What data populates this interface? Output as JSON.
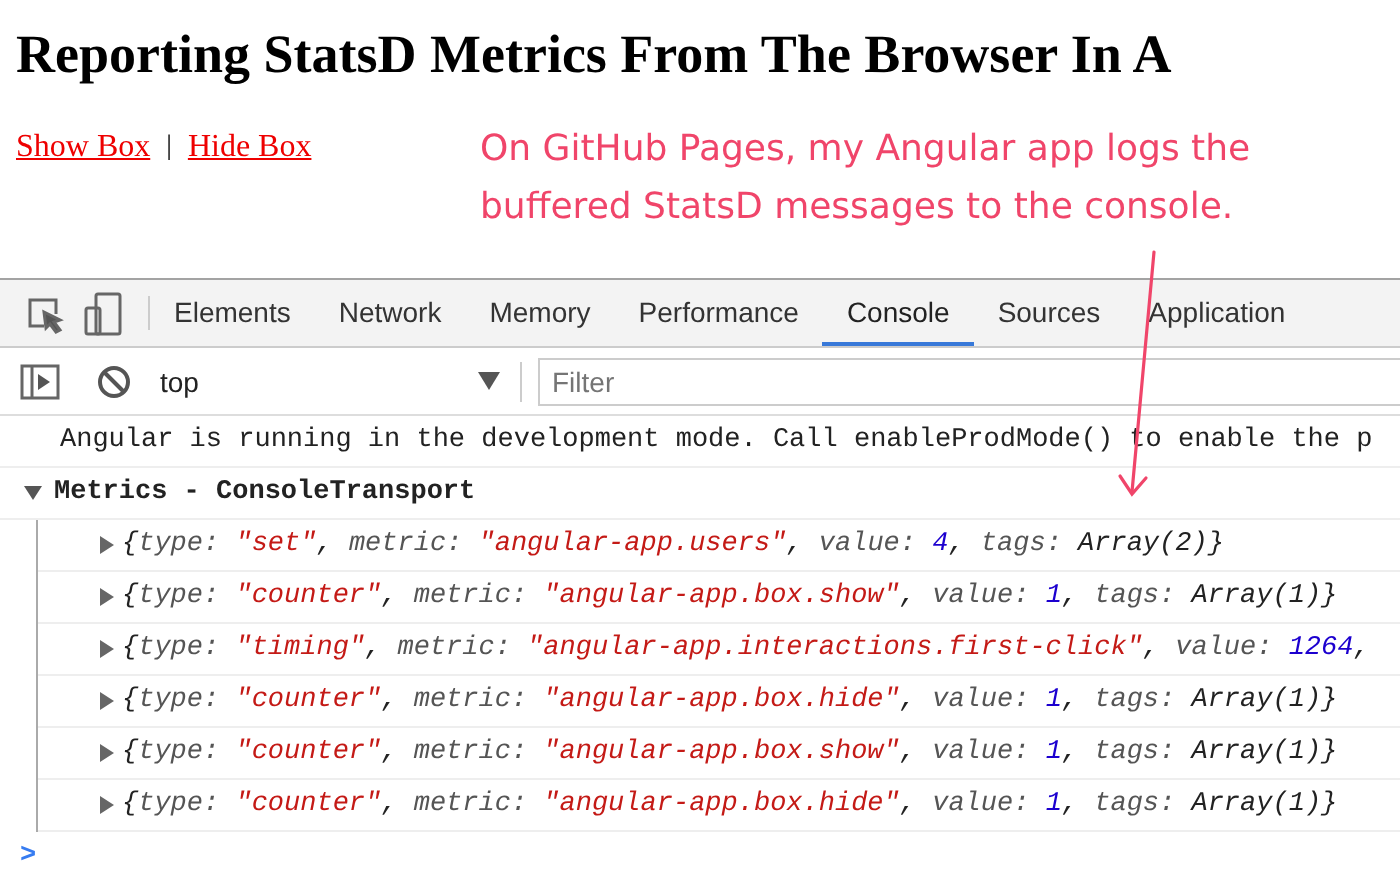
{
  "page": {
    "title": "Reporting StatsD Metrics From The Browser In A",
    "links": [
      {
        "label": "Show Box"
      },
      {
        "label": "Hide Box"
      }
    ],
    "separator": "|"
  },
  "annotation": {
    "lines": [
      "On GitHub Pages, my Angular app logs the",
      "buffered StatsD messages to the console."
    ]
  },
  "devtools": {
    "tabs": [
      {
        "label": "Elements",
        "selected": false
      },
      {
        "label": "Network",
        "selected": false
      },
      {
        "label": "Memory",
        "selected": false
      },
      {
        "label": "Performance",
        "selected": false
      },
      {
        "label": "Console",
        "selected": true
      },
      {
        "label": "Sources",
        "selected": false
      },
      {
        "label": "Application",
        "selected": false
      }
    ],
    "context": "top",
    "filter": {
      "placeholder": "Filter"
    },
    "messages": [
      {
        "kind": "info",
        "text": "Angular is running in the development mode. Call enableProdMode() to enable the p"
      },
      {
        "kind": "group",
        "text": "Metrics - ConsoleTransport",
        "expanded": true,
        "children": [
          {
            "parts": [
              {
                "kind": "p",
                "text": "{"
              },
              {
                "kind": "k",
                "text": "type: "
              },
              {
                "kind": "s",
                "text": "\"set\""
              },
              {
                "kind": "p",
                "text": ", "
              },
              {
                "kind": "k",
                "text": "metric: "
              },
              {
                "kind": "s",
                "text": "\"angular-app.users\""
              },
              {
                "kind": "p",
                "text": ", "
              },
              {
                "kind": "k",
                "text": "value: "
              },
              {
                "kind": "n",
                "text": "4"
              },
              {
                "kind": "p",
                "text": ", "
              },
              {
                "kind": "k",
                "text": "tags: "
              },
              {
                "kind": "p",
                "text": "Array(2)}"
              }
            ]
          },
          {
            "parts": [
              {
                "kind": "p",
                "text": "{"
              },
              {
                "kind": "k",
                "text": "type: "
              },
              {
                "kind": "s",
                "text": "\"counter\""
              },
              {
                "kind": "p",
                "text": ", "
              },
              {
                "kind": "k",
                "text": "metric: "
              },
              {
                "kind": "s",
                "text": "\"angular-app.box.show\""
              },
              {
                "kind": "p",
                "text": ", "
              },
              {
                "kind": "k",
                "text": "value: "
              },
              {
                "kind": "n",
                "text": "1"
              },
              {
                "kind": "p",
                "text": ", "
              },
              {
                "kind": "k",
                "text": "tags: "
              },
              {
                "kind": "p",
                "text": "Array(1)}"
              }
            ]
          },
          {
            "parts": [
              {
                "kind": "p",
                "text": "{"
              },
              {
                "kind": "k",
                "text": "type: "
              },
              {
                "kind": "s",
                "text": "\"timing\""
              },
              {
                "kind": "p",
                "text": ", "
              },
              {
                "kind": "k",
                "text": "metric: "
              },
              {
                "kind": "s",
                "text": "\"angular-app.interactions.first-click\""
              },
              {
                "kind": "p",
                "text": ", "
              },
              {
                "kind": "k",
                "text": "value: "
              },
              {
                "kind": "n",
                "text": "1264"
              },
              {
                "kind": "p",
                "text": ","
              }
            ]
          },
          {
            "parts": [
              {
                "kind": "p",
                "text": "{"
              },
              {
                "kind": "k",
                "text": "type: "
              },
              {
                "kind": "s",
                "text": "\"counter\""
              },
              {
                "kind": "p",
                "text": ", "
              },
              {
                "kind": "k",
                "text": "metric: "
              },
              {
                "kind": "s",
                "text": "\"angular-app.box.hide\""
              },
              {
                "kind": "p",
                "text": ", "
              },
              {
                "kind": "k",
                "text": "value: "
              },
              {
                "kind": "n",
                "text": "1"
              },
              {
                "kind": "p",
                "text": ", "
              },
              {
                "kind": "k",
                "text": "tags: "
              },
              {
                "kind": "p",
                "text": "Array(1)}"
              }
            ]
          },
          {
            "parts": [
              {
                "kind": "p",
                "text": "{"
              },
              {
                "kind": "k",
                "text": "type: "
              },
              {
                "kind": "s",
                "text": "\"counter\""
              },
              {
                "kind": "p",
                "text": ", "
              },
              {
                "kind": "k",
                "text": "metric: "
              },
              {
                "kind": "s",
                "text": "\"angular-app.box.show\""
              },
              {
                "kind": "p",
                "text": ", "
              },
              {
                "kind": "k",
                "text": "value: "
              },
              {
                "kind": "n",
                "text": "1"
              },
              {
                "kind": "p",
                "text": ", "
              },
              {
                "kind": "k",
                "text": "tags: "
              },
              {
                "kind": "p",
                "text": "Array(1)}"
              }
            ]
          },
          {
            "parts": [
              {
                "kind": "p",
                "text": "{"
              },
              {
                "kind": "k",
                "text": "type: "
              },
              {
                "kind": "s",
                "text": "\"counter\""
              },
              {
                "kind": "p",
                "text": ", "
              },
              {
                "kind": "k",
                "text": "metric: "
              },
              {
                "kind": "s",
                "text": "\"angular-app.box.hide\""
              },
              {
                "kind": "p",
                "text": ", "
              },
              {
                "kind": "k",
                "text": "value: "
              },
              {
                "kind": "n",
                "text": "1"
              },
              {
                "kind": "p",
                "text": ", "
              },
              {
                "kind": "k",
                "text": "tags: "
              },
              {
                "kind": "p",
                "text": "Array(1)}"
              }
            ]
          }
        ]
      }
    ],
    "prompt": ">"
  }
}
